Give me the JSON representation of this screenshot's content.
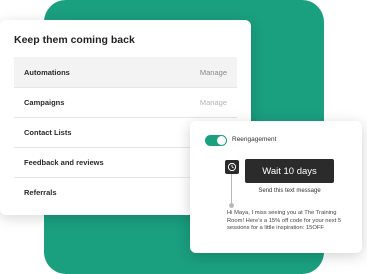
{
  "colors": {
    "brand_green": "#1a9f7f",
    "dark": "#2b2b2b"
  },
  "main_card": {
    "title": "Keep them coming back",
    "rows": [
      {
        "label": "Automations",
        "action": "Manage"
      },
      {
        "label": "Campaigns",
        "action": "Manage"
      },
      {
        "label": "Contact Lists",
        "action": ""
      },
      {
        "label": "Feedback and reviews",
        "action": ""
      },
      {
        "label": "Referrals",
        "action": ""
      }
    ]
  },
  "automation_card": {
    "toggle_state": "on",
    "toggle_label": "Reengagement",
    "step_icon": "clock-icon",
    "wait_label": "Wait 10 days",
    "send_label": "Send this text message",
    "message_text": "Hi Maya, I miss seeing you at The Training Room! Here's a 15% off code for your next 5 sessions for a little inspiration: 15OFF"
  }
}
